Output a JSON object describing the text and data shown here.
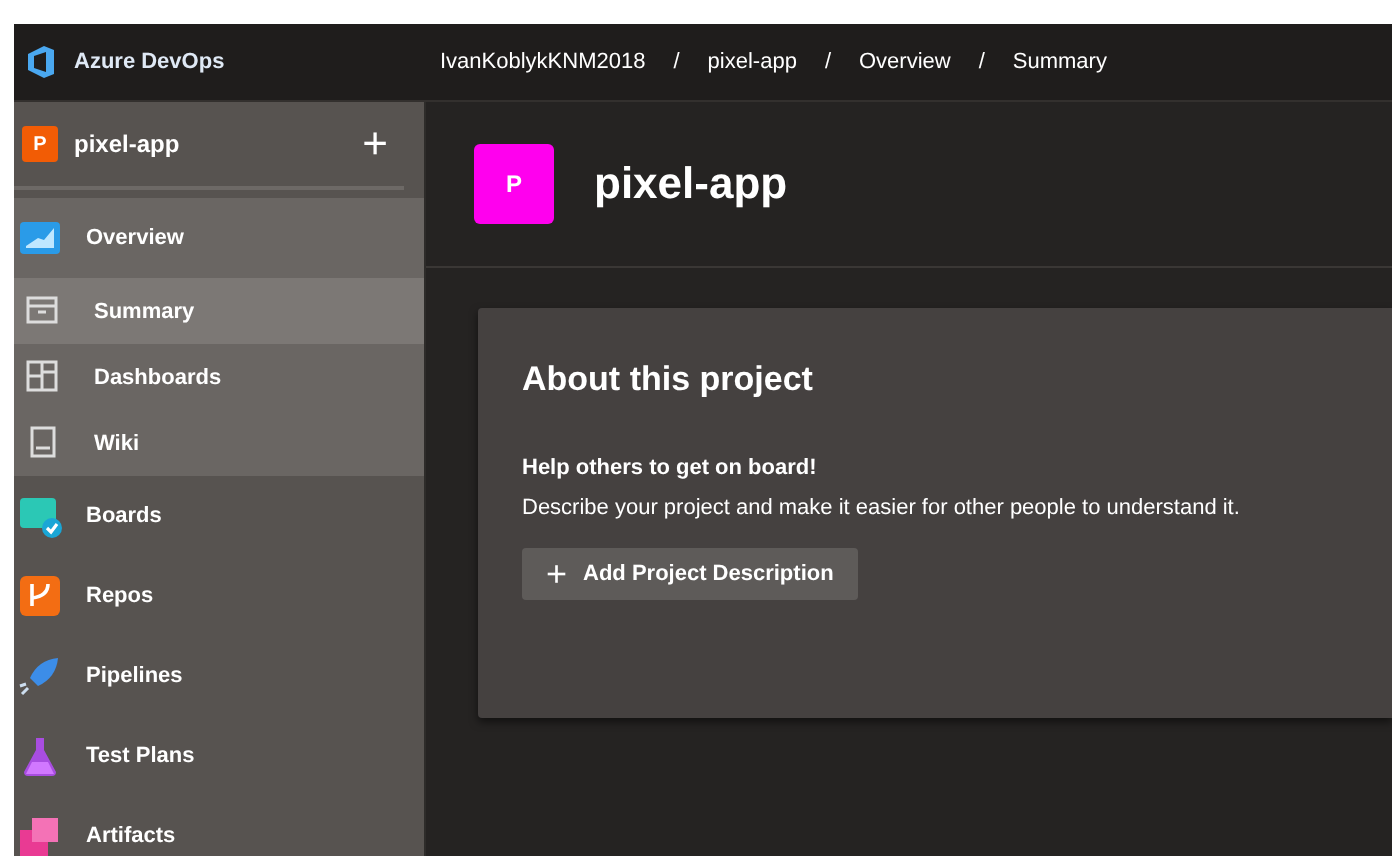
{
  "header": {
    "product": "Azure DevOps",
    "breadcrumb": [
      "IvanKoblykKNM2018",
      "pixel-app",
      "Overview",
      "Summary"
    ],
    "breadcrumb_separator": "/"
  },
  "sidebar": {
    "project": {
      "initial": "P",
      "name": "pixel-app",
      "add": "+"
    },
    "items": [
      {
        "label": "Overview",
        "expanded": true,
        "selected": false,
        "children": [
          {
            "label": "Summary",
            "selected": true
          },
          {
            "label": "Dashboards",
            "selected": false
          },
          {
            "label": "Wiki",
            "selected": false
          }
        ]
      },
      {
        "label": "Boards",
        "selected": false
      },
      {
        "label": "Repos",
        "selected": false
      },
      {
        "label": "Pipelines",
        "selected": false
      },
      {
        "label": "Test Plans",
        "selected": false
      },
      {
        "label": "Artifacts",
        "selected": false
      }
    ]
  },
  "main": {
    "project": {
      "initial": "P",
      "name": "pixel-app"
    },
    "card": {
      "title": "About this project",
      "subtitle": "Help others to get on board!",
      "text": "Describe your project and make it easier for other people to understand it.",
      "button": {
        "icon": "+",
        "label": "Add Project Description"
      }
    }
  }
}
